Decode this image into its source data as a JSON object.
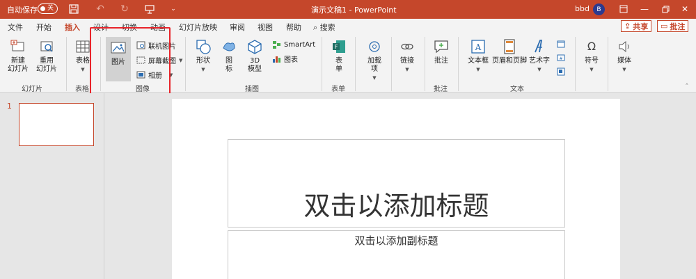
{
  "titlebar": {
    "autosave_label": "自动保存",
    "autosave_state": "关",
    "doc_title": "演示文稿1  -  PowerPoint",
    "user_name": "bbd",
    "avatar_initial": "B"
  },
  "tabs": [
    {
      "label": "文件"
    },
    {
      "label": "开始"
    },
    {
      "label": "插入"
    },
    {
      "label": "设计"
    },
    {
      "label": "切换"
    },
    {
      "label": "动画"
    },
    {
      "label": "幻灯片放映"
    },
    {
      "label": "审阅"
    },
    {
      "label": "视图"
    },
    {
      "label": "帮助"
    },
    {
      "label": "搜索"
    }
  ],
  "share_label": "共享",
  "comment_label": "批注",
  "ribbon": {
    "slides": {
      "new_slide": "新建\n幻灯片",
      "reuse_slide": "重用\n幻灯片",
      "group": "幻灯片"
    },
    "tables": {
      "table": "表格",
      "group": "表格"
    },
    "images": {
      "picture": "图片",
      "online_picture": "联机图片",
      "screenshot": "屏幕截图",
      "album": "相册",
      "group": "图像"
    },
    "illustrations": {
      "shapes": "形状",
      "icons": "图\n标",
      "model3d": "3D\n模型",
      "smartart": "SmartArt",
      "chart": "图表",
      "group": "插图"
    },
    "forms": {
      "form": "表\n单",
      "group": "表单"
    },
    "addins": {
      "addin": "加载\n项"
    },
    "links": {
      "link": "链接"
    },
    "comments": {
      "comment": "批注",
      "group": "批注"
    },
    "text": {
      "textbox": "文本框",
      "header_footer": "页眉和页脚",
      "wordart": "艺术字",
      "group": "文本"
    },
    "symbols": {
      "symbol": "符号"
    },
    "media": {
      "media": "媒体"
    }
  },
  "slides_pane": {
    "slide_number": "1"
  },
  "slide": {
    "title_placeholder": "双击以添加标题",
    "subtitle_placeholder": "双击以添加副标题"
  },
  "colors": {
    "accent": "#c5472b",
    "highlight": "#e8242a"
  }
}
